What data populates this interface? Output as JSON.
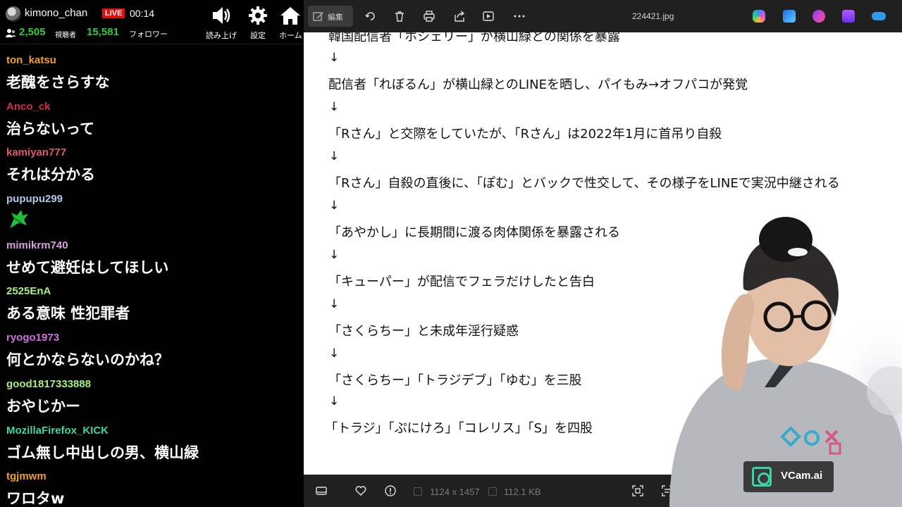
{
  "stream": {
    "streamer_name": "kimono_chan",
    "live_badge": "LIVE",
    "elapsed": "00:14",
    "viewers": "2,505",
    "viewers_label": "視聴者",
    "followers": "15,581",
    "followers_label": "フォロワー",
    "buttons": {
      "tts": "読み上げ",
      "settings": "設定",
      "home": "ホーム"
    }
  },
  "chat": [
    {
      "user": "ton_katsu",
      "color": "#f0a030",
      "text": "老醜をさらすな"
    },
    {
      "user": "Anco_ck",
      "color": "#d0304a",
      "text": "治らないって"
    },
    {
      "user": "kamiyan777",
      "color": "#e05870",
      "text": "それは分かる"
    },
    {
      "user": "pupupu299",
      "color": "#b0c8e8",
      "text": "",
      "emote": "green-emote"
    },
    {
      "user": "mimikrm740",
      "color": "#d8a0e0",
      "text": "せめて避妊はしてほしい"
    },
    {
      "user": "2525EnA",
      "color": "#a8f07a",
      "text": "ある意味 性犯罪者"
    },
    {
      "user": "ryogo1973",
      "color": "#d070e0",
      "text": "何とかならないのかね？"
    },
    {
      "user": "good1817333888",
      "color": "#a8f07a",
      "text": "おやじかー"
    },
    {
      "user": "MozillaFirefox_KICK",
      "color": "#40d8a0",
      "text": "ゴム無し中出しの男、横山緑"
    },
    {
      "user": "tgjmwm",
      "color": "#f0a030",
      "text": "ワロタw"
    }
  ],
  "viewer": {
    "edit_label": "編集",
    "file_name": "224421.jpg",
    "dimensions": "1124 x 1457",
    "file_size": "112.1 KB",
    "toolbar_icons": [
      "edit-icon",
      "rotate-icon",
      "delete-icon",
      "print-icon",
      "share-icon",
      "slideshow-icon",
      "more-icon"
    ],
    "app_icons": [
      "copilot-icon",
      "designer-icon",
      "clipchamp-icon",
      "stack-icon",
      "onedrive-icon"
    ],
    "document": {
      "lines": [
        "韓国配信者「ホシェリー」が横山緑との関係を暴露",
        "↓",
        "配信者「れぼるん」が横山緑とのLINEを晒し、パイもみ→オフパコが発覚",
        "↓",
        "「Rさん」と交際をしていたが、「Rさん」は2022年1月に首吊り自殺",
        "↓",
        "「Rさん」自殺の直後に、「ぽむ」とバックで性交して、その様子をLINEで実況中継される",
        "↓",
        "「あやかし」に長期間に渡る肉体関係を暴露される",
        "↓",
        "「キューパー」が配信でフェラだけしたと告白",
        "↓",
        "「さくらちー」と未成年淫行疑惑",
        "↓",
        "「さくらちー」「トラジデブ」「ゆむ」を三股",
        "↓",
        "「トラジ」「ぷにけろ」「コレリス」「S」を四股"
      ]
    }
  },
  "overlay": {
    "vcam_label": "VCam.ai"
  }
}
